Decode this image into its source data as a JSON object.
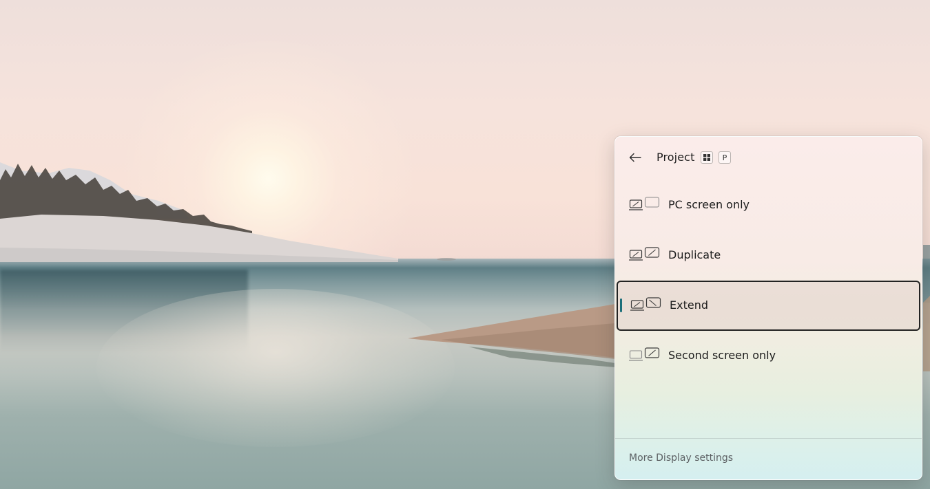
{
  "flyout": {
    "title": "Project",
    "shortcut_keys": [
      "win-key-icon",
      "P"
    ],
    "back_icon": "arrow-left-icon",
    "options": [
      {
        "label": "PC screen only",
        "icon": "pc-screen-only-icon",
        "selected": false
      },
      {
        "label": "Duplicate",
        "icon": "duplicate-icon",
        "selected": false
      },
      {
        "label": "Extend",
        "icon": "extend-icon",
        "selected": true
      },
      {
        "label": "Second screen only",
        "icon": "second-screen-only-icon",
        "selected": false
      }
    ],
    "footer_link": "More Display settings"
  },
  "colors": {
    "selection_accent": "#1d6f7a",
    "selection_border": "#232323"
  }
}
